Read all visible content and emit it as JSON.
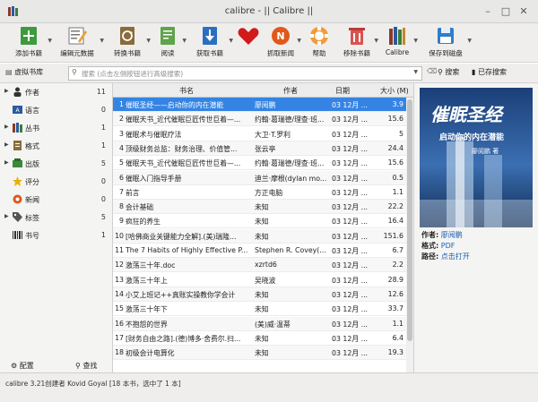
{
  "window": {
    "title": "calibre - || Calibre ||"
  },
  "toolbar": {
    "items": [
      {
        "label": "添加书籍"
      },
      {
        "label": "编辑元数据"
      },
      {
        "label": "转换书籍"
      },
      {
        "label": "阅读"
      },
      {
        "label": "获取书籍"
      },
      {
        "label": ""
      },
      {
        "label": "抓取新闻"
      },
      {
        "label": "帮助"
      },
      {
        "label": "移除书籍"
      },
      {
        "label": "Calibre"
      },
      {
        "label": "保存到磁盘"
      }
    ]
  },
  "searchbar": {
    "virtual_library": "虚拟书库",
    "placeholder": "搜索 (点击左侧按钮进行高级搜索)",
    "search_button": "搜索",
    "saved_search_button": "已存搜索"
  },
  "sidebar": {
    "items": [
      {
        "label": "作者",
        "count": "11",
        "icon": "person-icon"
      },
      {
        "label": "语言",
        "count": "0",
        "icon": "language-icon"
      },
      {
        "label": "丛书",
        "count": "1",
        "icon": "series-icon"
      },
      {
        "label": "格式",
        "count": "1",
        "icon": "format-icon"
      },
      {
        "label": "出版",
        "count": "5",
        "icon": "publisher-icon"
      },
      {
        "label": "评分",
        "count": "0",
        "icon": "star-icon"
      },
      {
        "label": "新闻",
        "count": "0",
        "icon": "news-icon"
      },
      {
        "label": "标签",
        "count": "5",
        "icon": "tag-icon"
      },
      {
        "label": "书号",
        "count": "1",
        "icon": "isbn-icon"
      }
    ],
    "configure_label": "配置",
    "find_label": "查找"
  },
  "table": {
    "headers": {
      "title": "书名",
      "author": "作者",
      "date": "日期",
      "size": "大小 (M)"
    },
    "rows": [
      {
        "num": "1",
        "title": "催眠圣经——启动你的内在潜能",
        "author": "廖阅鹏",
        "date": "03 12月 ...",
        "size": "3.9"
      },
      {
        "num": "2",
        "title": "催眠天书_近代催眠巨匠传世巨着—...",
        "author": "约翰·葛瑞德/理查·班...",
        "date": "03 12月 ...",
        "size": "15.6"
      },
      {
        "num": "3",
        "title": "催眠术与催眠疗法",
        "author": "大卫·T.罗利",
        "date": "03 12月 ...",
        "size": "5"
      },
      {
        "num": "4",
        "title": "顶级财务总监：财务治理、价值管...",
        "author": "张云亭",
        "date": "03 12月 ...",
        "size": "24.4"
      },
      {
        "num": "5",
        "title": "催眠天书_近代催眠巨匠传世巨着—...",
        "author": "约翰·葛瑞德/理查·班...",
        "date": "03 12月 ...",
        "size": "15.6"
      },
      {
        "num": "6",
        "title": "催眠入门指导手册",
        "author": "迪兰·摩根(dylan mo...",
        "date": "03 12月 ...",
        "size": "0.5"
      },
      {
        "num": "7",
        "title": "前言",
        "author": "方正电脑",
        "date": "03 12月 ...",
        "size": "1.1"
      },
      {
        "num": "8",
        "title": "会计基础",
        "author": "未知",
        "date": "03 12月 ...",
        "size": "22.2"
      },
      {
        "num": "9",
        "title": "疯狂的养生",
        "author": "未知",
        "date": "03 12月 ...",
        "size": "16.4"
      },
      {
        "num": "10",
        "title": "[哈佛商业关键能力全解].(美)瑞隆...",
        "author": "未知",
        "date": "03 12月 ...",
        "size": "151.6"
      },
      {
        "num": "11",
        "title": "The 7 Habits of Highly Effective P...",
        "author": "Stephen R. Covey(...",
        "date": "03 12月 ...",
        "size": "6.7"
      },
      {
        "num": "12",
        "title": "激荡三十年.doc",
        "author": "xzrtd6",
        "date": "03 12月 ...",
        "size": "2.2"
      },
      {
        "num": "13",
        "title": "激荡三十年上",
        "author": "吴晓波",
        "date": "03 12月 ...",
        "size": "28.9"
      },
      {
        "num": "14",
        "title": "小艾上班记++真账实操教你学会计",
        "author": "未知",
        "date": "03 12月 ...",
        "size": "12.6"
      },
      {
        "num": "15",
        "title": "激荡三十年下",
        "author": "未知",
        "date": "03 12月 ...",
        "size": "33.7"
      },
      {
        "num": "16",
        "title": "不抱怨的世界",
        "author": "(美)威·温蒂",
        "date": "03 12月 ...",
        "size": "1.1"
      },
      {
        "num": "17",
        "title": "[财务自由之路].(德)博多·舍费尔.扫...",
        "author": "未知",
        "date": "03 12月 ...",
        "size": "6.4"
      },
      {
        "num": "18",
        "title": "初级会计电算化",
        "author": "未知",
        "date": "03 12月 ...",
        "size": "19.3"
      }
    ]
  },
  "details": {
    "cover": {
      "title": "催眠圣经",
      "subtitle": "启动你的内在潜能",
      "author": "廖阅鹏 著"
    },
    "author_label": "作者:",
    "author_value": "廖阅鹏",
    "format_label": "格式:",
    "format_value": "PDF",
    "path_label": "路径:",
    "path_value": "点击打开"
  },
  "status": {
    "text": "calibre 3.21创建者 Kovid Goyal   [18 本书，选中了 1 本]"
  },
  "colors": {
    "selection": "#3584e4",
    "toolbar_bg": "#efeeed",
    "link": "#1a5fb4"
  }
}
